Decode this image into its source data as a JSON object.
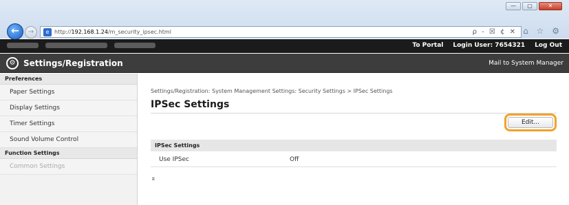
{
  "browser": {
    "url_prefix": "http://",
    "url_host": "192.168.1.24",
    "url_path": "/m_security_ipsec.html",
    "addr_tools": "ρ - ☒ ¢ ✕",
    "toolbar_icons": "⌂ ☆ ⚙",
    "win_min": "—",
    "win_max": "▢",
    "win_close": "✕",
    "back_glyph": "←",
    "fwd_glyph": "→"
  },
  "topbar": {
    "to_portal": "To Portal",
    "login_user": "Login User:  7654321",
    "log_out": "Log Out"
  },
  "header": {
    "title": "Settings/Registration",
    "mail_link": "Mail to System Manager"
  },
  "sidebar": {
    "sections": [
      {
        "title": "Preferences",
        "items": [
          "Paper Settings",
          "Display Settings",
          "Timer Settings",
          "Sound Volume Control"
        ]
      },
      {
        "title": "Function Settings",
        "items": [
          "Common Settings"
        ]
      }
    ]
  },
  "main": {
    "breadcrumb": "Settings/Registration: System Management Settings: Security Settings > IPSec Settings",
    "page_title": "IPSec Settings",
    "edit_label": "Edit...",
    "section_title": "IPSec Settings",
    "rows": [
      {
        "label": "Use IPSec",
        "value": "Off"
      }
    ],
    "to_top": "⌅"
  }
}
